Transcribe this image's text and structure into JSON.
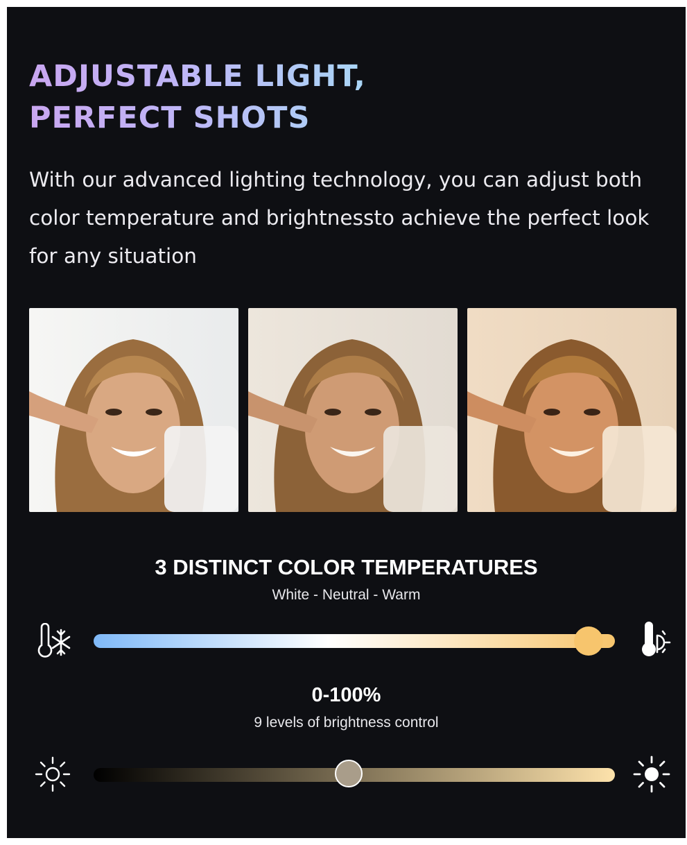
{
  "headline": {
    "line1": "ADJUSTABLE LIGHT,",
    "line2": "PERFECT SHOTS"
  },
  "intro": "With our advanced lighting technology, you can adjust both color temperature and brightnessto achieve the perfect look for any situation",
  "photos": [
    {
      "tone": "white"
    },
    {
      "tone": "neutral"
    },
    {
      "tone": "warm"
    }
  ],
  "color_temperature": {
    "title": "3 DISTINCT COLOR TEMPERATURES",
    "subtitle": "White - Neutral - Warm",
    "value_fraction": 0.95,
    "left_icon": "cold-thermometer-icon",
    "right_icon": "warm-thermometer-icon",
    "colors": {
      "start": "#7fb9f8",
      "mid": "#ffffff",
      "end": "#f7c56d"
    }
  },
  "brightness": {
    "title": "0-100%",
    "subtitle": "9 levels of brightness control",
    "value_fraction": 0.49,
    "left_icon": "dim-sun-icon",
    "right_icon": "bright-sun-icon",
    "colors": {
      "start": "#000000",
      "end": "#fde2ab",
      "knob": "#a99d8a"
    }
  }
}
